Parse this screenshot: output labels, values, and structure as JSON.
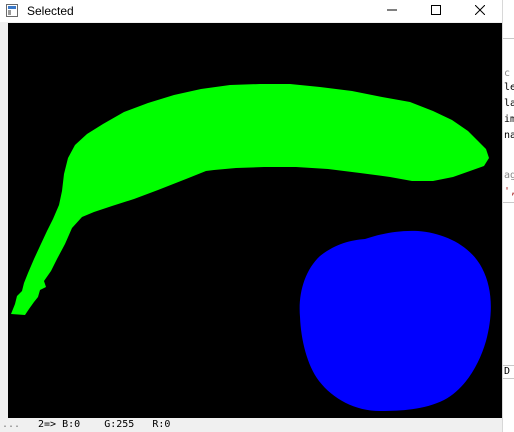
{
  "window": {
    "title": "Selected",
    "icons": {
      "app": "app-window-icon",
      "minimize": "minimize-icon",
      "maximize": "maximize-icon",
      "close": "close-icon"
    }
  },
  "canvas": {
    "background_color": "#000000",
    "shapes": [
      {
        "name": "banana",
        "color": "#00ff00"
      },
      {
        "name": "round-fruit",
        "color": "#0000ff"
      }
    ]
  },
  "status_bar": {
    "fragment": "...",
    "pixel_info": "2=> B:0    G:255   R:0"
  },
  "background_window": {
    "fragments": [
      "c",
      "le",
      "la",
      "im",
      "na",
      "ag",
      "',",
      "D"
    ]
  }
}
